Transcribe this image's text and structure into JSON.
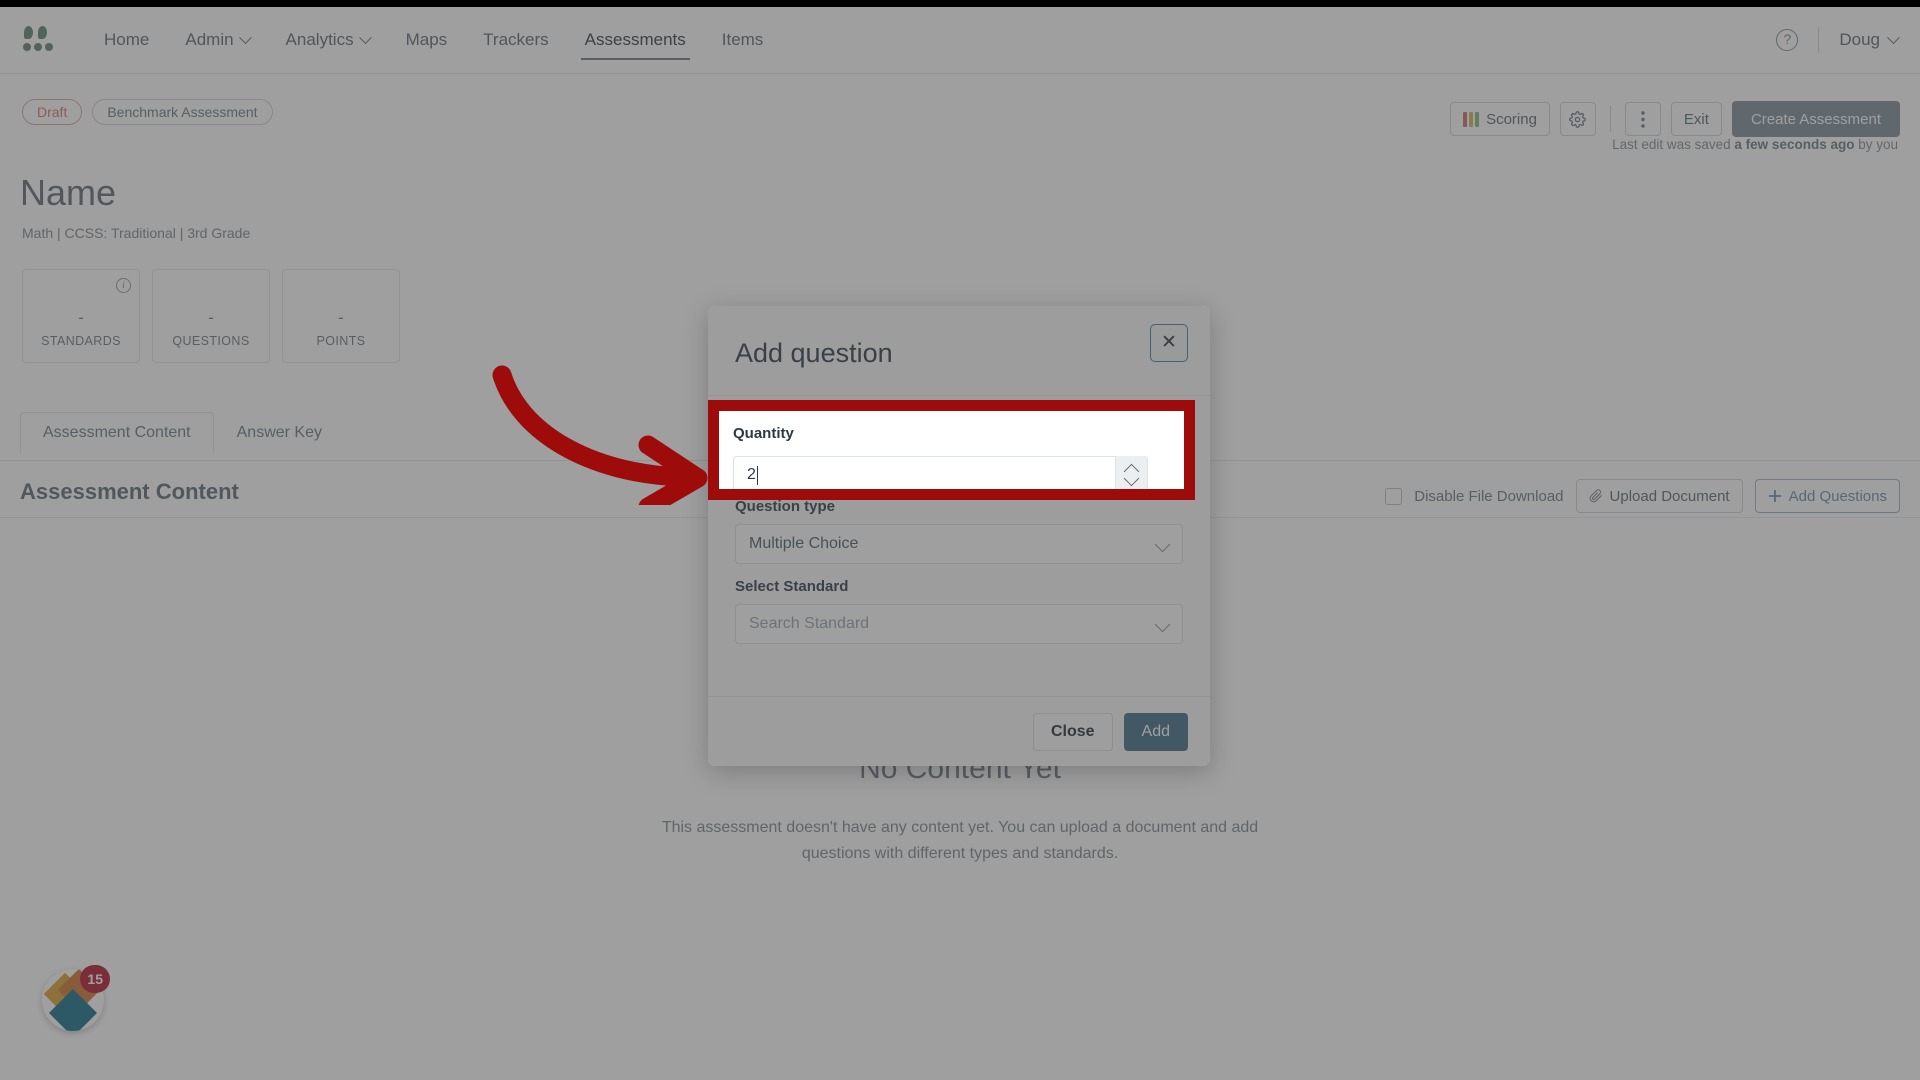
{
  "nav": {
    "logo": "company-logo",
    "items": [
      {
        "label": "Home",
        "dropdown": false,
        "active": false
      },
      {
        "label": "Admin",
        "dropdown": true,
        "active": false
      },
      {
        "label": "Analytics",
        "dropdown": true,
        "active": false
      },
      {
        "label": "Maps",
        "dropdown": false,
        "active": false
      },
      {
        "label": "Trackers",
        "dropdown": false,
        "active": false
      },
      {
        "label": "Assessments",
        "dropdown": false,
        "active": true
      },
      {
        "label": "Items",
        "dropdown": false,
        "active": false
      }
    ],
    "help": "?",
    "user": "Doug"
  },
  "header": {
    "status_badge": "Draft",
    "type_badge": "Benchmark Assessment",
    "title": "Name",
    "subtitle": "Math  |  CCSS: Traditional  |  3rd Grade",
    "last_edit": "Last edit was saved ",
    "last_edit_bold": "a few seconds ago",
    "last_edit_tail": " by you",
    "stats": [
      {
        "value": "-",
        "label": "STANDARDS",
        "has_info": true
      },
      {
        "value": "-",
        "label": "QUESTIONS",
        "has_info": false
      },
      {
        "value": "-",
        "label": "POINTS",
        "has_info": false
      }
    ],
    "actions": {
      "scoring": "Scoring",
      "settings_icon": "gear-icon",
      "more_icon": "kebab-menu-icon",
      "exit": "Exit",
      "create": "Create Assessment"
    },
    "colors": {
      "scoring_red": "#cf6b6b",
      "scoring_yellow": "#d4b45c",
      "scoring_green": "#7fba7a",
      "draft": "#d4776b",
      "primary": "#7b8d99"
    }
  },
  "tabs": [
    {
      "label": "Assessment Content",
      "active": true
    },
    {
      "label": "Answer Key",
      "active": false
    }
  ],
  "content": {
    "section_title": "Assessment Content",
    "disable_download_label": "Disable File Download",
    "upload_label": "Upload Document",
    "add_questions_label": "Add Questions",
    "empty_title": "No Content Yet",
    "empty_body": "This assessment doesn't have any content yet. You can upload a document and add questions with different types and standards."
  },
  "fab": {
    "badge_count": "15",
    "badge_color": "#b3112a"
  },
  "modal": {
    "title": "Add question",
    "close_icon": "close-icon",
    "fields": {
      "quantity_label": "Quantity",
      "quantity_value": "2",
      "question_type_label": "Question type",
      "question_type_value": "Multiple Choice",
      "standard_label": "Select Standard",
      "standard_placeholder": "Search Standard"
    },
    "buttons": {
      "close": "Close",
      "add": "Add"
    }
  },
  "annotation": {
    "highlight_color": "#9e0b0b",
    "arrow": "curved-arrow-pointing-right",
    "target": "quantity-field"
  }
}
